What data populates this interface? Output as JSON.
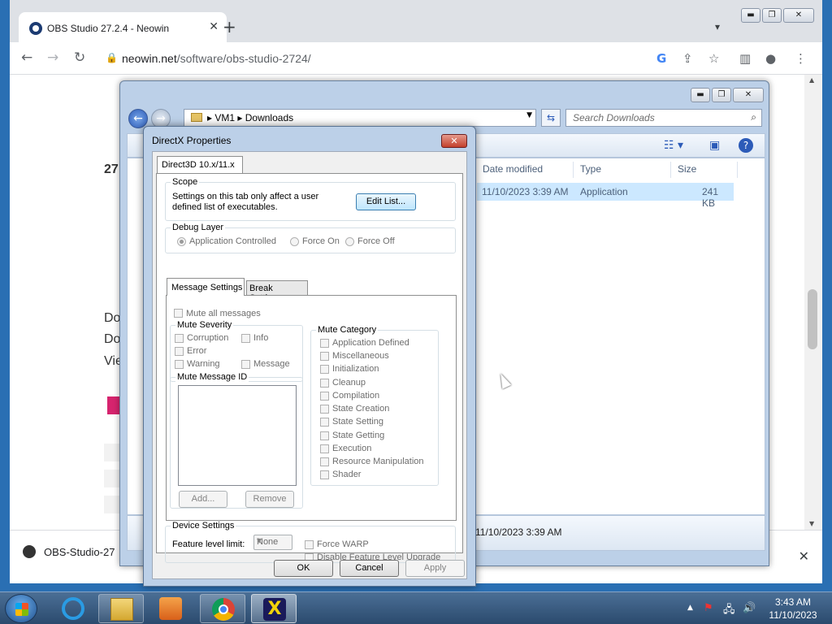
{
  "browser": {
    "tab_title": "OBS Studio 27.2.4 - Neowin",
    "url_host": "neowin.net",
    "url_path": "/software/obs-studio-2724/",
    "page_fragments": [
      "27",
      "Do",
      "Do",
      "Vie"
    ],
    "download_item": "OBS-Studio-27"
  },
  "explorer": {
    "path": [
      "VM1",
      "Downloads"
    ],
    "search_placeholder": "Search Downloads",
    "columns": [
      "Date modified",
      "Type",
      "Size"
    ],
    "row": {
      "date": "11/10/2023 3:39 AM",
      "type": "Application",
      "size": "241 KB"
    },
    "details_date": "11/10/2023 3:39 AM"
  },
  "dialog": {
    "title": "DirectX Properties",
    "tab": "Direct3D 10.x/11.x",
    "scope": {
      "label": "Scope",
      "text_line1": "Settings on this tab only affect a user",
      "text_line2": "defined list of executables.",
      "edit_button": "Edit List..."
    },
    "debug_layer": {
      "label": "Debug Layer",
      "options": [
        "Application Controlled",
        "Force On",
        "Force Off"
      ]
    },
    "subtabs": [
      "Message Settings",
      "Break Settings"
    ],
    "mute_all": "Mute all messages",
    "mute_severity": {
      "label": "Mute Severity",
      "items": [
        "Corruption",
        "Info",
        "Error",
        "Warning",
        "Message"
      ]
    },
    "mute_message_id": {
      "label": "Mute Message ID",
      "add": "Add...",
      "remove": "Remove"
    },
    "mute_category": {
      "label": "Mute Category",
      "items": [
        "Application Defined",
        "Miscellaneous",
        "Initialization",
        "Cleanup",
        "Compilation",
        "State Creation",
        "State Setting",
        "State Getting",
        "Execution",
        "Resource Manipulation",
        "Shader"
      ]
    },
    "device_settings": {
      "label": "Device Settings",
      "feature_label": "Feature level limit:",
      "feature_value": "None",
      "force_warp": "Force WARP",
      "disable_upgrade": "Disable Feature Level Upgrade"
    },
    "buttons": {
      "ok": "OK",
      "cancel": "Cancel",
      "apply": "Apply"
    }
  },
  "taskbar": {
    "time": "3:43 AM",
    "date": "11/10/2023"
  }
}
